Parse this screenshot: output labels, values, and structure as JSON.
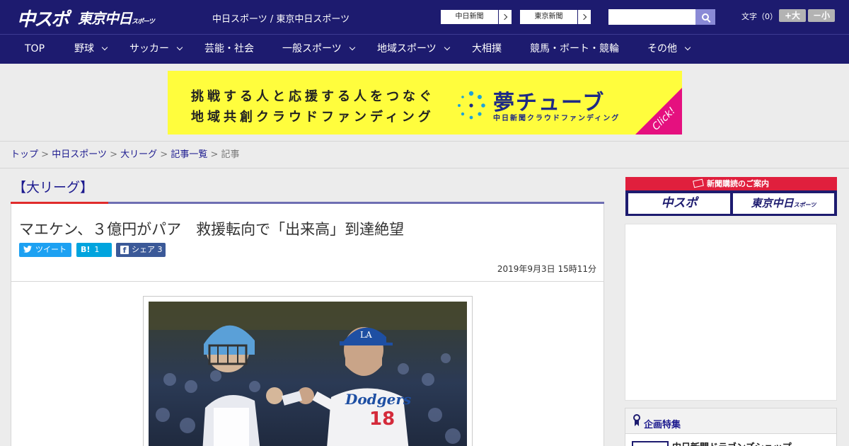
{
  "header": {
    "logo_chuspo": "中スポ",
    "logo_tokyo": "東京中日",
    "logo_tokyo_small": "スポーツ",
    "site_names": "中日スポーツ / 東京中日スポーツ",
    "site_links": [
      {
        "label": "中日新聞"
      },
      {
        "label": "東京新聞"
      }
    ],
    "search_placeholder": "",
    "font_size_label": "文字（0）",
    "font_increase": "+大",
    "font_decrease": "－小"
  },
  "nav": {
    "items": [
      {
        "label": "TOP",
        "has_dropdown": false
      },
      {
        "label": "野球",
        "has_dropdown": true
      },
      {
        "label": "サッカー",
        "has_dropdown": true
      },
      {
        "label": "芸能・社会",
        "has_dropdown": false
      },
      {
        "label": "一般スポーツ",
        "has_dropdown": true
      },
      {
        "label": "地域スポーツ",
        "has_dropdown": true
      },
      {
        "label": "大相撲",
        "has_dropdown": false
      },
      {
        "label": "競馬・ボート・競輪",
        "has_dropdown": false
      },
      {
        "label": "その他",
        "has_dropdown": true
      }
    ]
  },
  "ad_banner": {
    "line1": "挑戦する人と応援する人をつなぐ",
    "line2": "地域共創クラウドファンディング",
    "logo": "夢チューブ",
    "sub": "中日新聞クラウドファンディング",
    "click": "Click!"
  },
  "breadcrumb": {
    "items": [
      "トップ",
      "中日スポーツ",
      "大リーグ",
      "記事一覧"
    ],
    "current": "記事",
    "separator": ">"
  },
  "article": {
    "category": "【大リーグ】",
    "title": "マエケン、３億円がパア　救援転向で「出来高」到達絶望",
    "share": {
      "tweet": "ツイート",
      "hatena": "1",
      "facebook": "シェア 3"
    },
    "date": "2019年9月3日 15時11分",
    "photo_jersey_number": "18",
    "photo_jersey_text": "Dodgers"
  },
  "sidebar": {
    "subscribe_head": "新聞購読のご案内",
    "subscribe_logo1": "中スポ",
    "subscribe_logo2": "東京中日",
    "subscribe_logo2_small": "スポーツ",
    "feature_title": "企画特集",
    "feature_item": "中日新聞ドラゴンズショップ"
  },
  "colors": {
    "brand_navy": "#1d1b6f",
    "accent_red": "#e02b2b",
    "ad_yellow": "#fffd3d",
    "ad_magenta": "#e5107f",
    "twitter": "#1da1f2",
    "hatena": "#00a4de",
    "facebook": "#3b5998"
  }
}
